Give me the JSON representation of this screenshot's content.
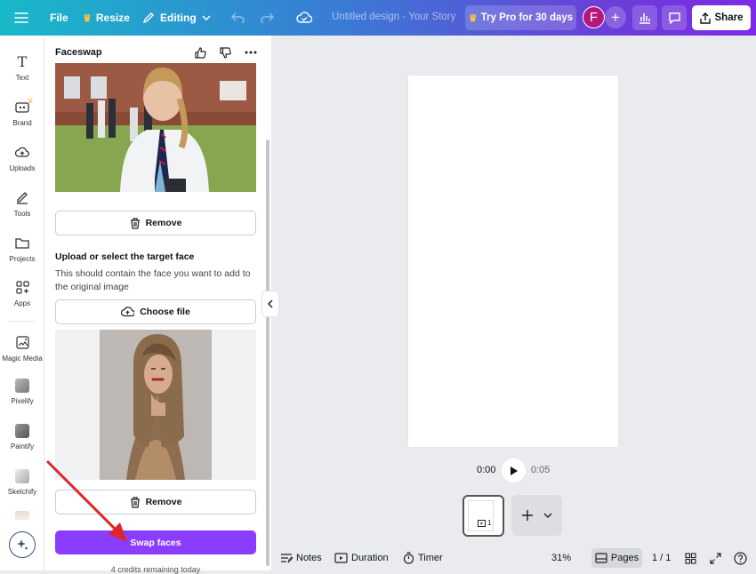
{
  "topbar": {
    "file_label": "File",
    "resize_label": "Resize",
    "editing_label": "Editing",
    "title": "Untitled design - Your Story",
    "pro_label": "Try Pro for 30 days",
    "avatar_initial": "F",
    "share_label": "Share"
  },
  "rail": {
    "items": [
      {
        "label": "Text",
        "icon": "text-icon"
      },
      {
        "label": "Brand",
        "icon": "brand-icon"
      },
      {
        "label": "Uploads",
        "icon": "upload-cloud-icon"
      },
      {
        "label": "Tools",
        "icon": "pen-icon"
      },
      {
        "label": "Projects",
        "icon": "folder-icon"
      },
      {
        "label": "Apps",
        "icon": "apps-grid-icon"
      },
      {
        "label": "Magic Media",
        "icon": "magic-media-icon"
      },
      {
        "label": "Pixelify",
        "icon": "pixelify-app-icon"
      },
      {
        "label": "Paintify",
        "icon": "paintify-app-icon"
      },
      {
        "label": "Sketchify",
        "icon": "sketchify-app-icon"
      }
    ]
  },
  "panel": {
    "title": "Faceswap",
    "remove_label_1": "Remove",
    "target_heading": "Upload or select the target face",
    "target_desc": "This should contain the face you want to add to the original image",
    "choose_file_label": "Choose file",
    "remove_label_2": "Remove",
    "swap_label": "Swap faces",
    "credits_text": "4 credits remaining today"
  },
  "editor": {
    "time_current": "0:00",
    "time_total": "0:05",
    "page_number": "1"
  },
  "bottombar": {
    "notes_label": "Notes",
    "duration_label": "Duration",
    "timer_label": "Timer",
    "zoom": "31%",
    "pages_label": "Pages",
    "page_count": "1 / 1"
  },
  "colors": {
    "accent": "#8b3dff",
    "avatar": "#b5177a",
    "arrow": "#e0242b"
  }
}
